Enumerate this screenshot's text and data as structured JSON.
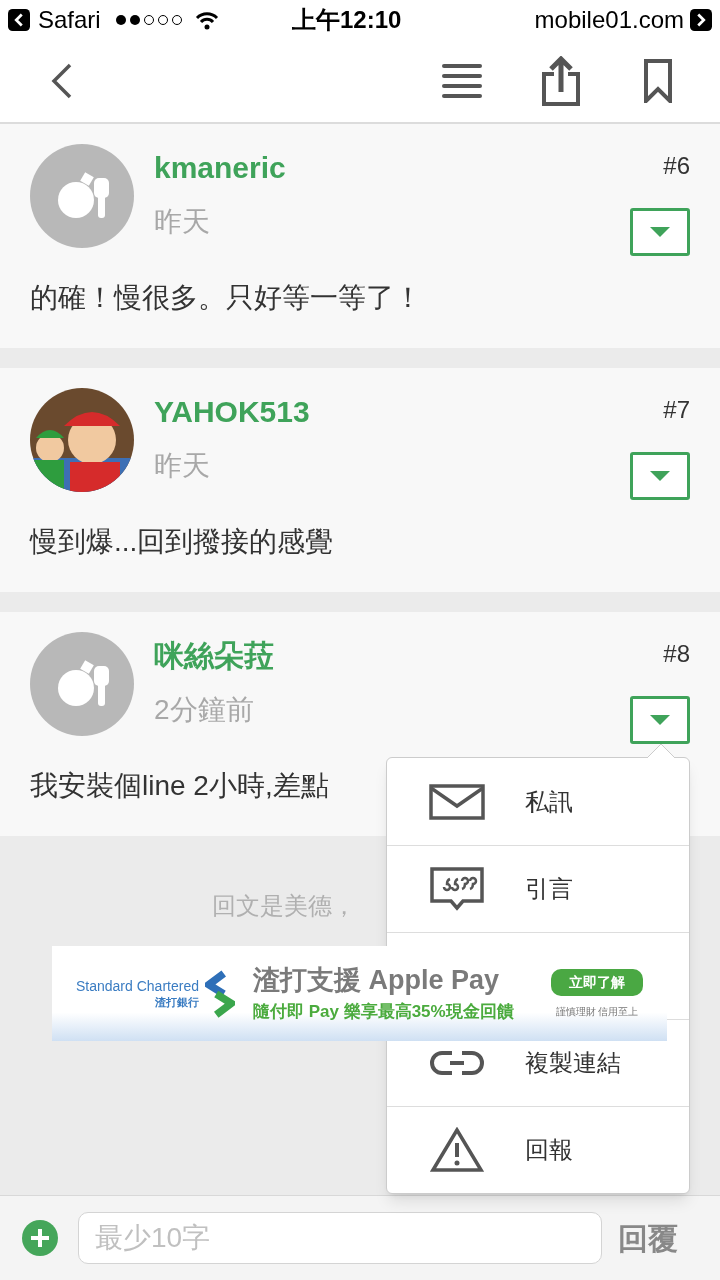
{
  "status_bar": {
    "back_app": "Safari",
    "time": "上午12:10",
    "site": "mobile01.com"
  },
  "posts": [
    {
      "username": "kmaneric",
      "time": "昨天",
      "floor": "#6",
      "body": "的確！慢很多。只好等一等了！",
      "avatar": {
        "kind": "default"
      }
    },
    {
      "username": "YAHOK513",
      "time": "昨天",
      "floor": "#7",
      "body": "慢到爆...回到撥接的感覺"
    },
    {
      "username": "咪絲朵菈",
      "time": "2分鐘前",
      "floor": "#8",
      "body": "我安裝個line 2小時,差點",
      "avatar": {
        "kind": "default"
      }
    }
  ],
  "footer_note": "回文是美德，",
  "menu": {
    "items": [
      {
        "kind": "mail",
        "label": "私訊"
      },
      {
        "kind": "quote",
        "label": "引言"
      },
      {
        "kind": "hidden"
      },
      {
        "kind": "link",
        "label": "複製連結"
      },
      {
        "kind": "warning",
        "label": "回報"
      }
    ]
  },
  "ad": {
    "bank_name": "Standard Chartered",
    "bank_name_zh": "渣打銀行",
    "headline": "渣打支援 Apple Pay",
    "subline": "隨付即 Pay 樂享最高35%現金回饋",
    "cta": "立即了解",
    "disclaimer": "謹慎理財 信用至上"
  },
  "reply_bar": {
    "placeholder": "最少10字",
    "send": "回覆"
  }
}
